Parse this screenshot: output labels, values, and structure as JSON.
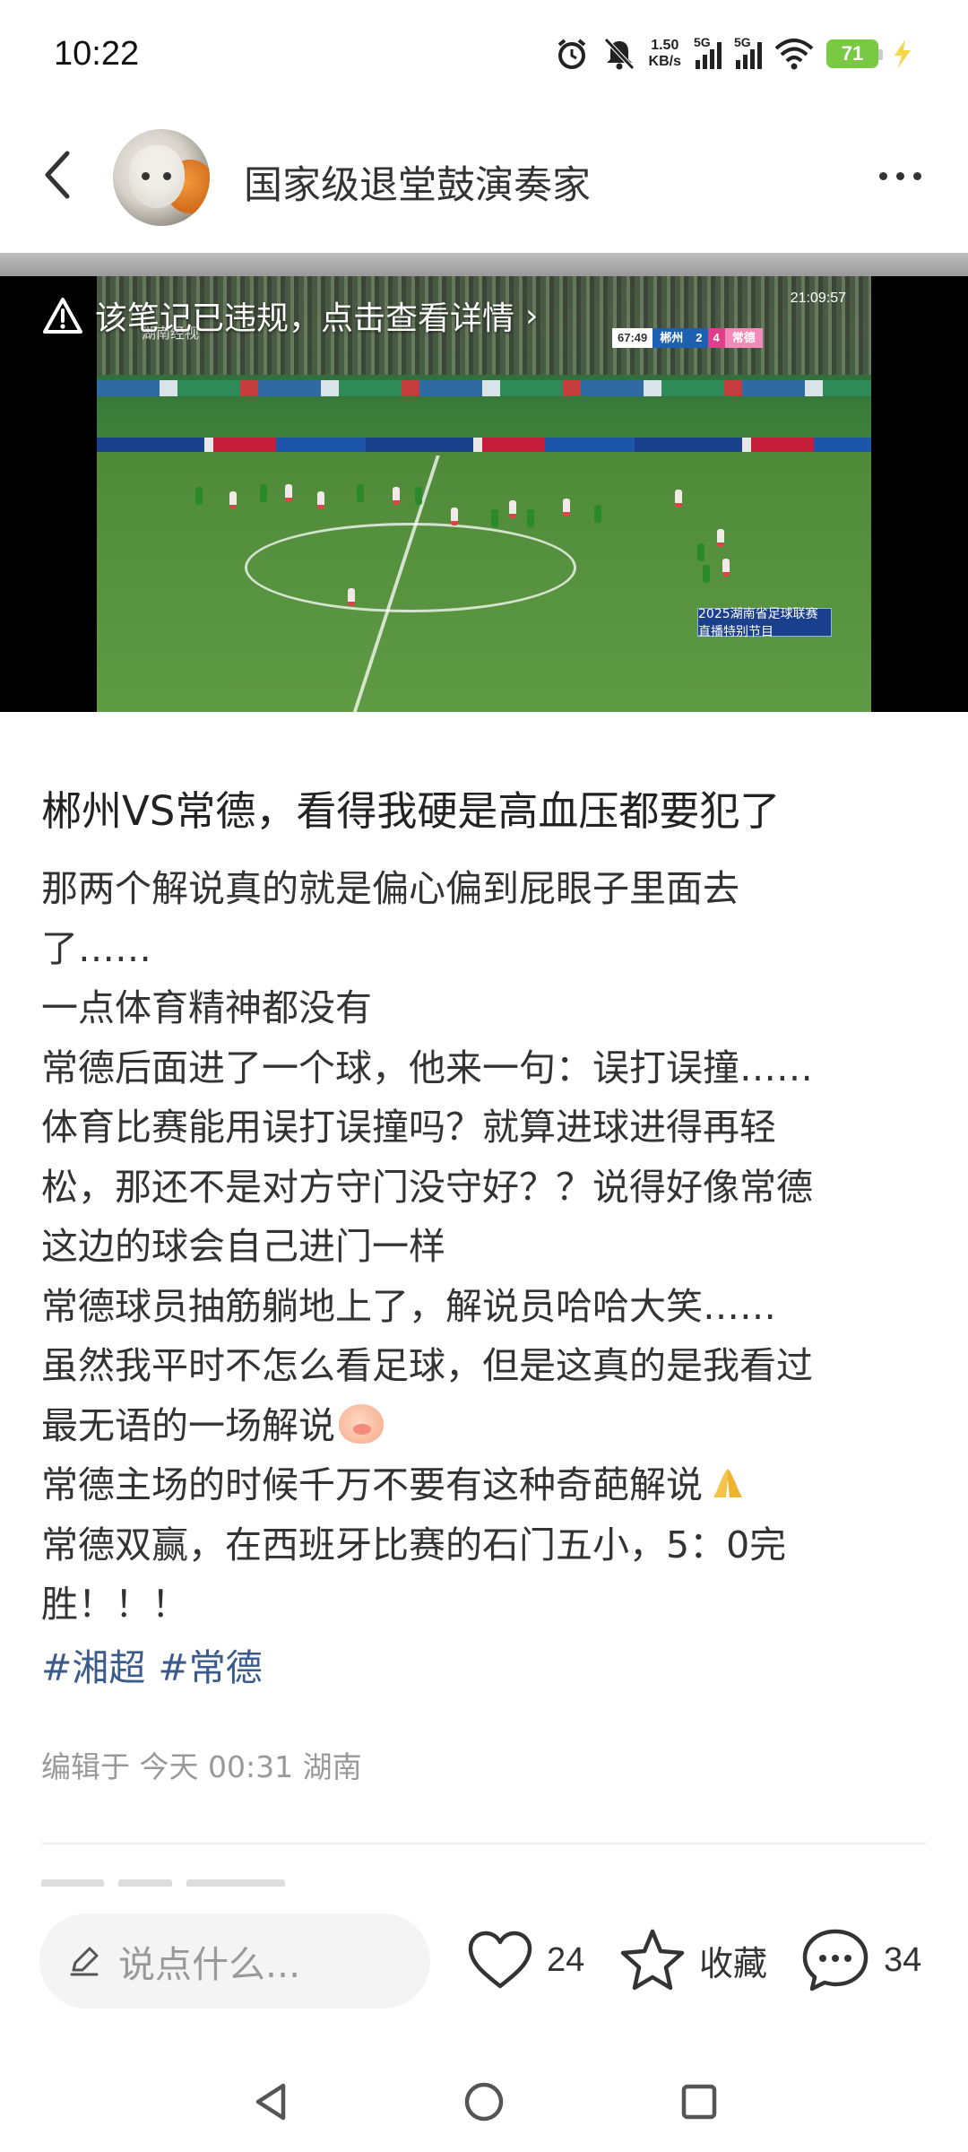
{
  "status_bar": {
    "time": "10:22",
    "net_speed_value": "1.50",
    "net_speed_unit": "KB/s",
    "signal1_label": "5G",
    "signal2_label": "5G",
    "battery_level": "71",
    "icons": [
      "alarm-icon",
      "mute-icon",
      "wifi-icon",
      "charging-icon"
    ]
  },
  "header": {
    "username": "国家级退堂鼓演奏家"
  },
  "video": {
    "violation_notice": "该笔记已违规，点击查看详情",
    "violation_arrow": "›",
    "clock": "21:09:57",
    "channel": "湖南经视",
    "scoreboard": {
      "time": "67:49",
      "home_team": "郴州",
      "home_score": "2",
      "away_score": "4",
      "away_team": "常德"
    },
    "broadcast_tag": "2025湖南省足球联赛 直播特别节目"
  },
  "post": {
    "title": "郴州VS常德，看得我硬是高血压都要犯了",
    "lines": [
      "那两个解说真的就是偏心偏到屁眼子里面去",
      "了……",
      "一点体育精神都没有",
      "常德后面进了一个球，他来一句：误打误撞……",
      "体育比赛能用误打误撞吗？就算进球进得再轻",
      "松，那还不是对方守门没守好？？说得好像常德",
      "这边的球会自己进门一样",
      "常德球员抽筋躺地上了，解说员哈哈大笑……",
      "虽然我平时不怎么看足球，但是这真的是我看过",
      "最无语的一场解说",
      "常德主场的时候千万不要有这种奇葩解说",
      "常德双赢，在西班牙比赛的石门五小，5：0完",
      "胜！！！"
    ],
    "hashtags": [
      "#湘超",
      "#常德"
    ],
    "edit_info": "编辑于 今天 00:31 湖南"
  },
  "bottom_bar": {
    "comment_placeholder": "说点什么...",
    "likes": "24",
    "collect_label": "收藏",
    "comments": "34"
  },
  "colors": {
    "hashtag": "#3a5b8c",
    "battery": "#7ac943",
    "muted_text": "#999999"
  }
}
